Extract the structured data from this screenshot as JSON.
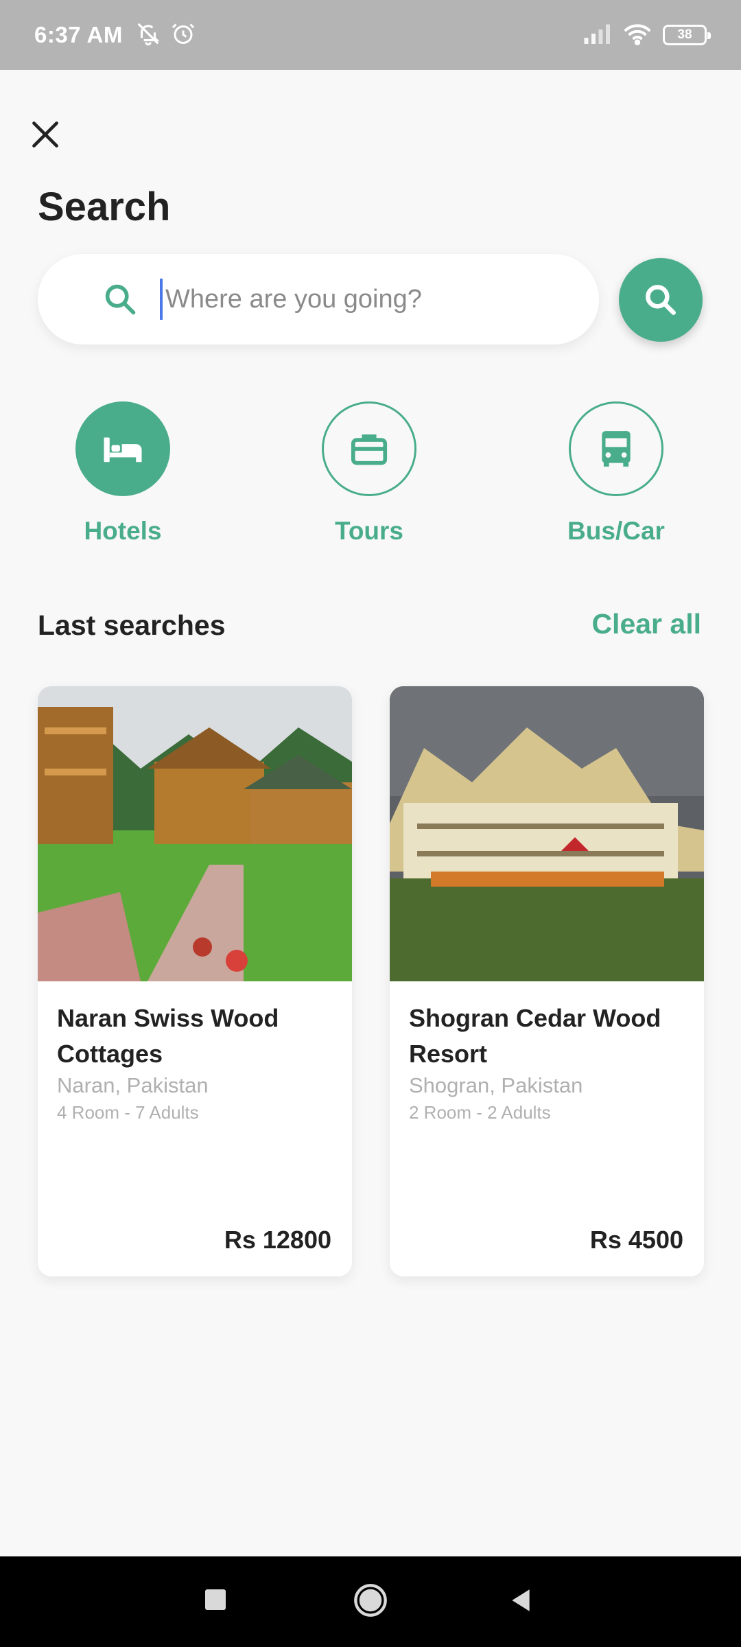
{
  "status_bar": {
    "time": "6:37 AM",
    "icons_left": [
      "mute-bell-icon",
      "alarm-icon"
    ],
    "icons_right": [
      "signal-icon",
      "wifi-icon",
      "battery-icon"
    ],
    "battery": "38"
  },
  "header": {
    "close_icon": "close-icon",
    "title": "Search"
  },
  "search": {
    "placeholder": "Where are you going?",
    "value": ""
  },
  "categories": [
    {
      "label": "Hotels",
      "icon": "bed-icon",
      "active": true
    },
    {
      "label": "Tours",
      "icon": "briefcase-icon",
      "active": false
    },
    {
      "label": "Bus/Car",
      "icon": "bus-icon",
      "active": false
    }
  ],
  "last_searches": {
    "title": "Last searches",
    "clear_label": "Clear all",
    "items": [
      {
        "name": "Naran Swiss Wood Cottages",
        "location": "Naran, Pakistan",
        "guests": "4 Room - 7 Adults",
        "price": "Rs 12800"
      },
      {
        "name": "Shogran Cedar Wood Resort",
        "location": "Shogran, Pakistan",
        "guests": "2 Room - 2 Adults",
        "price": "Rs 4500"
      }
    ]
  },
  "colors": {
    "accent": "#49ad8b",
    "status_bar": "#b4b4b4",
    "background": "#f8f8f8"
  },
  "nav_bar": [
    "recents-square-icon",
    "home-circle-icon",
    "back-triangle-icon"
  ]
}
